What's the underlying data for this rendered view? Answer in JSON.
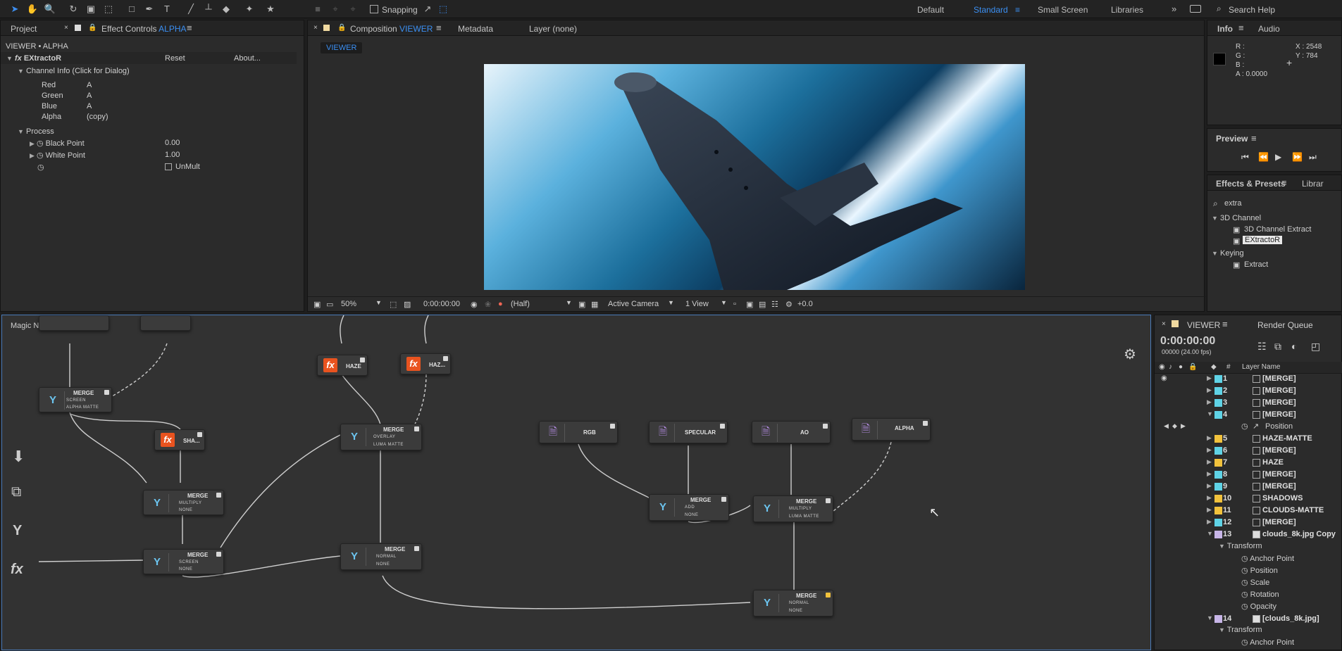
{
  "toolbar": {
    "snapping_label": "Snapping",
    "workspaces": [
      "Default",
      "Standard",
      "Small Screen",
      "Libraries"
    ],
    "search_placeholder": "Search Help"
  },
  "effect_controls": {
    "tabs": {
      "project": "Project",
      "effect_controls": "Effect Controls",
      "layer_name": "ALPHA"
    },
    "breadcrumb": "VIEWER • ALPHA",
    "effect_name": "EXtractoR",
    "reset": "Reset",
    "about": "About...",
    "channel_info": "Channel Info (Click for Dialog)",
    "channels": [
      {
        "label": "Red",
        "value": "A"
      },
      {
        "label": "Green",
        "value": "A"
      },
      {
        "label": "Blue",
        "value": "A"
      },
      {
        "label": "Alpha",
        "value": "(copy)"
      }
    ],
    "process": "Process",
    "black_point_label": "Black Point",
    "black_point_value": "0.00",
    "white_point_label": "White Point",
    "white_point_value": "1.00",
    "unmult_label": "UnMult"
  },
  "composition": {
    "tab_label": "Composition",
    "tab_comp": "VIEWER",
    "metadata": "Metadata",
    "layer": "Layer (none)",
    "viewer_tab": "VIEWER",
    "zoom": "50%",
    "timecode": "0:00:00:00",
    "resolution": "(Half)",
    "camera": "Active Camera",
    "views": "1 View",
    "exposure": "+0.0"
  },
  "info": {
    "tab_info": "Info",
    "tab_audio": "Audio",
    "r": "R :",
    "g": "G :",
    "b": "B :",
    "a": "A : 0.0000",
    "x": "X : 2548",
    "y": "Y : 784"
  },
  "preview": {
    "title": "Preview"
  },
  "effects_presets": {
    "title": "Effects & Presets",
    "tab2": "Librar",
    "search_value": "extra",
    "groups": [
      {
        "name": "3D Channel",
        "items": [
          "3D Channel Extract",
          "EXtractoR"
        ]
      },
      {
        "name": "Keying",
        "items": [
          "Extract"
        ]
      }
    ]
  },
  "magic_nodes": {
    "title": "Magic Nodes",
    "nodes": [
      {
        "title": "MERGE",
        "sub1": "SCREEN",
        "sub2": "ALPHA MATTE"
      },
      {
        "title": "SHA...",
        "sub1": "",
        "sub2": ""
      },
      {
        "title": "MERGE",
        "sub1": "MULTIPLY",
        "sub2": "NONE"
      },
      {
        "title": "MERGE",
        "sub1": "SCREEN",
        "sub2": "NONE"
      },
      {
        "title": "HAZE",
        "sub1": "",
        "sub2": ""
      },
      {
        "title": "HAZ...",
        "sub1": "",
        "sub2": ""
      },
      {
        "title": "MERGE",
        "sub1": "OVERLAY",
        "sub2": "LUMA MATTE"
      },
      {
        "title": "MERGE",
        "sub1": "NORMAL",
        "sub2": "NONE"
      },
      {
        "title": "RGB",
        "sub1": "",
        "sub2": ""
      },
      {
        "title": "SPECULAR",
        "sub1": "",
        "sub2": ""
      },
      {
        "title": "AO",
        "sub1": "",
        "sub2": ""
      },
      {
        "title": "ALPHA",
        "sub1": "",
        "sub2": ""
      },
      {
        "title": "MERGE",
        "sub1": "ADD",
        "sub2": "NONE"
      },
      {
        "title": "MERGE",
        "sub1": "MULTIPLY",
        "sub2": "LUMA MATTE"
      },
      {
        "title": "MERGE",
        "sub1": "NORMAL",
        "sub2": "NONE"
      }
    ]
  },
  "timeline": {
    "tab": "VIEWER",
    "render_queue": "Render Queue",
    "timecode": "0:00:00:00",
    "frame_info": "00000 (24.00 fps)",
    "col_num": "#",
    "col_name": "Layer Name",
    "layers": [
      {
        "num": "1",
        "name": "[MERGE]",
        "color": "#5fd3e6"
      },
      {
        "num": "2",
        "name": "[MERGE]",
        "color": "#5fd3e6"
      },
      {
        "num": "3",
        "name": "[MERGE]",
        "color": "#5fd3e6"
      },
      {
        "num": "4",
        "name": "[MERGE]",
        "color": "#5fd3e6"
      },
      {
        "num": "5",
        "name": "HAZE-MATTE",
        "color": "#f2c23c"
      },
      {
        "num": "6",
        "name": "[MERGE]",
        "color": "#5fd3e6"
      },
      {
        "num": "7",
        "name": "HAZE",
        "color": "#f2c23c"
      },
      {
        "num": "8",
        "name": "[MERGE]",
        "color": "#5fd3e6"
      },
      {
        "num": "9",
        "name": "[MERGE]",
        "color": "#5fd3e6"
      },
      {
        "num": "10",
        "name": "SHADOWS",
        "color": "#f2c23c"
      },
      {
        "num": "11",
        "name": "CLOUDS-MATTE",
        "color": "#f2c23c"
      },
      {
        "num": "12",
        "name": "[MERGE]",
        "color": "#5fd3e6"
      },
      {
        "num": "13",
        "name": "clouds_8k.jpg Copy",
        "color": "#c8b6e8"
      },
      {
        "num": "14",
        "name": "[clouds_8k.jpg]",
        "color": "#c8b6e8"
      }
    ],
    "position": "Position",
    "transform": "Transform",
    "props": [
      "Anchor Point",
      "Position",
      "Scale",
      "Rotation",
      "Opacity"
    ],
    "transform2": "Transform",
    "anchor2": "Anchor Point"
  }
}
